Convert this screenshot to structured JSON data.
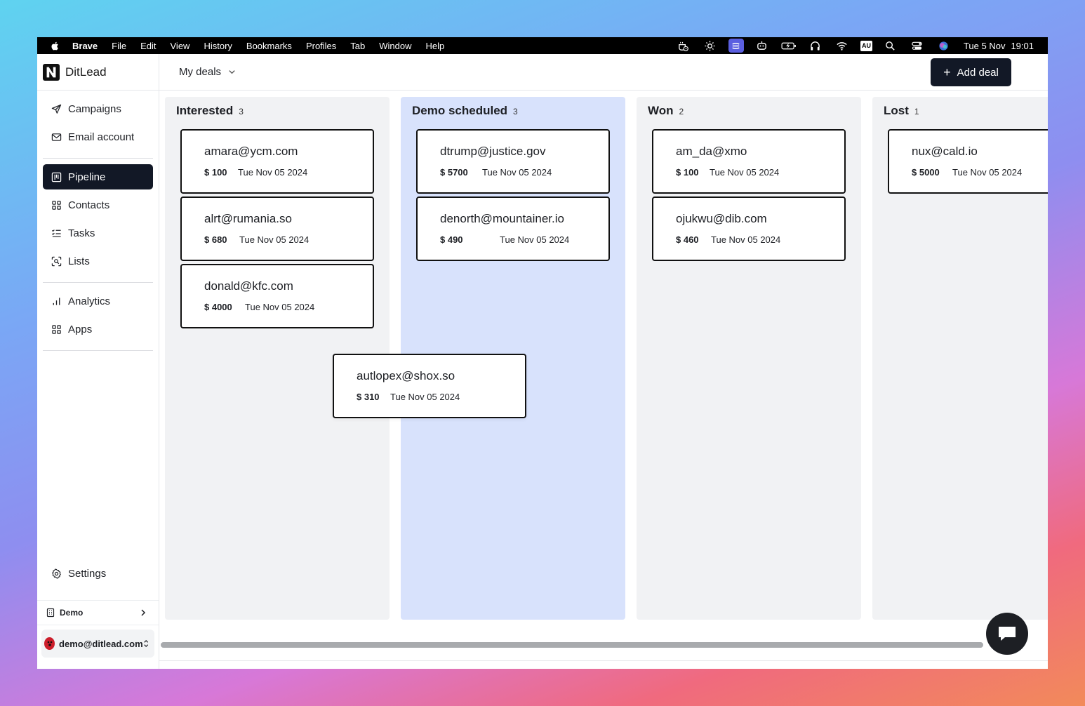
{
  "menubar": {
    "app": "Brave",
    "items": [
      "File",
      "Edit",
      "View",
      "History",
      "Bookmarks",
      "Profiles",
      "Tab",
      "Window",
      "Help"
    ],
    "status_badge": "AU",
    "date": "Tue 5 Nov",
    "time": "19:01"
  },
  "brand": {
    "name": "DitLead"
  },
  "sidebar": {
    "group1": [
      {
        "label": "Campaigns",
        "icon": "send-icon"
      },
      {
        "label": "Email account",
        "icon": "mail-icon"
      }
    ],
    "group2": [
      {
        "label": "Pipeline",
        "icon": "pipeline-icon",
        "active": true
      },
      {
        "label": "Contacts",
        "icon": "grid-icon"
      },
      {
        "label": "Tasks",
        "icon": "list-check-icon"
      },
      {
        "label": "Lists",
        "icon": "scan-icon"
      }
    ],
    "group3": [
      {
        "label": "Analytics",
        "icon": "bar-chart-icon"
      },
      {
        "label": "Apps",
        "icon": "apps-icon"
      }
    ],
    "settings_label": "Settings",
    "workspace": "Demo",
    "account": "demo@ditlead.com"
  },
  "header": {
    "view_selector": "My deals",
    "add_deal_label": "Add deal"
  },
  "board": {
    "columns": [
      {
        "title": "Interested",
        "count": "3",
        "cards": [
          {
            "email": "amara@ycm.com",
            "amount": "$ 100",
            "date": "Tue Nov 05 2024"
          },
          {
            "email": "alrt@rumania.so",
            "amount": "$ 680",
            "date": "Tue Nov 05 2024"
          },
          {
            "email": "donald@kfc.com",
            "amount": "$ 4000",
            "date": "Tue Nov 05 2024"
          }
        ]
      },
      {
        "title": "Demo scheduled",
        "count": "3",
        "cards": [
          {
            "email": "dtrump@justice.gov",
            "amount": "$ 5700",
            "date": "Tue Nov 05 2024"
          },
          {
            "email": "denorth@mountainer.io",
            "amount": "$ 490",
            "date": "Tue Nov 05 2024"
          }
        ]
      },
      {
        "title": "Won",
        "count": "2",
        "cards": [
          {
            "email": "am_da@xmo",
            "amount": "$ 100",
            "date": "Tue Nov 05 2024"
          },
          {
            "email": "ojukwu@dib.com",
            "amount": "$ 460",
            "date": "Tue Nov 05 2024"
          }
        ]
      },
      {
        "title": "Lost",
        "count": "1",
        "cards": [
          {
            "email": "nux@cald.io",
            "amount": "$ 5000",
            "date": "Tue Nov 05 2024"
          }
        ]
      }
    ],
    "dragging_card": {
      "email": "autlopex@shox.so",
      "amount": "$ 310",
      "date": "Tue Nov 05 2024"
    }
  },
  "colors": {
    "primary_dark": "#121826",
    "drop_target": "#d8e2fc",
    "column_bg": "#f1f2f4"
  }
}
